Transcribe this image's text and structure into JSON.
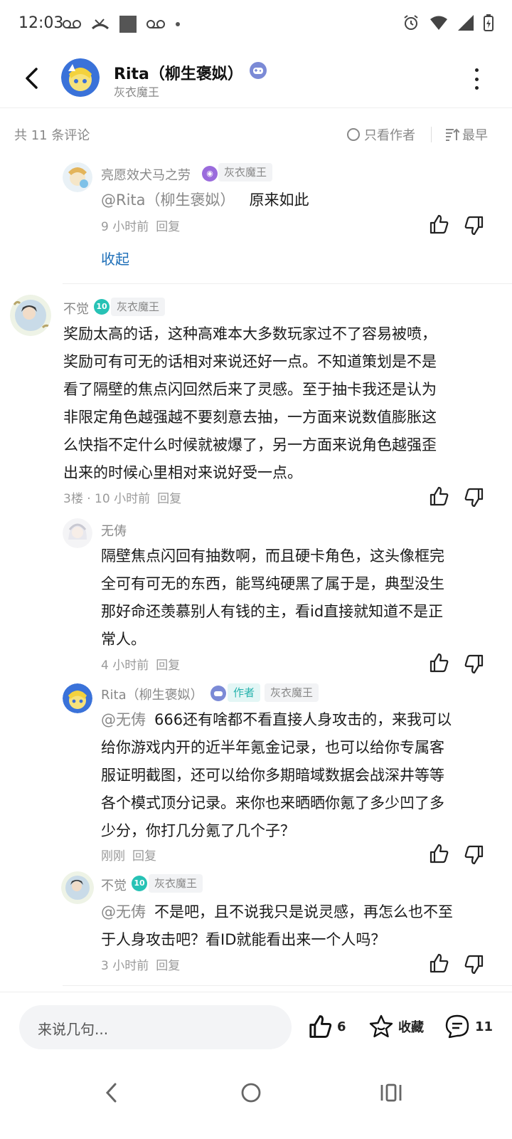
{
  "status_bar": {
    "time": "12:03",
    "icons_left": [
      "voicemail-icon",
      "missed-call-icon",
      "square-icon",
      "voicemail-icon",
      "dot-icon"
    ],
    "icons_right": [
      "alarm-icon",
      "wifi-icon",
      "signal-icon",
      "battery-icon"
    ]
  },
  "header": {
    "name": "Rita（柳生褒姒）",
    "subtitle": "灰衣魔王",
    "badge_icon": "gamepad-icon"
  },
  "filter_bar": {
    "count": "共 11 条评论",
    "author_only": "只看作者",
    "sort": "最早"
  },
  "comments": {
    "reply1": {
      "user": "亮愿效犬马之劳",
      "tag": "灰衣魔王",
      "mention": "@Rita（柳生褒姒）",
      "text": "原来如此",
      "time": "9 小时前",
      "reply": "回复"
    },
    "collapse": "收起",
    "main": {
      "user": "不觉",
      "level": "10",
      "tag": "灰衣魔王",
      "text": "奖励太高的话，这种高难本大多数玩家过不了容易被喷，奖励可有可无的话相对来说还好一点。不知道策划是不是看了隔壁的焦点闪回然后来了灵感。至于抽卡我还是认为非限定角色越强越不要刻意去抽，一方面来说数值膨胀这么快指不定什么时候就被爆了，另一方面来说角色越强歪出来的时候心里相对来说好受一点。",
      "lines": [
        "奖励太高的话，这种高难本大多数玩家过不了容易被喷，",
        "奖励可有可无的话相对来说还好一点。不知道策划是不是",
        "看了隔壁的焦点闪回然后来了灵感。至于抽卡我还是认为",
        "非限定角色越强越不要刻意去抽，一方面来说数值膨胀这",
        "么快指不定什么时候就被爆了，另一方面来说角色越强歪",
        "出来的时候心里相对来说好受一点。"
      ],
      "meta": "3楼 · 10 小时前",
      "reply": "回复"
    },
    "sub1": {
      "user": "无俦",
      "lines": [
        "隔壁焦点闪回有抽数啊，而且硬卡角色，这头像框完",
        "全可有可无的东西，能骂纯硬黑了属于是，典型没生",
        "那好命还羡慕别人有钱的主，看id直接就知道不是正",
        "常人。"
      ],
      "time": "4 小时前",
      "reply": "回复"
    },
    "sub2": {
      "user": "Rita（柳生褒姒）",
      "author_tag": "作者",
      "tag": "灰衣魔王",
      "mention": "@无俦",
      "lines": [
        "666还有啥都不看直接人身攻击的，来我可以",
        "给你游戏内开的近半年氪金记录，也可以给你专属客",
        "服证明截图，还可以给你多期暗域数据会战深井等等",
        "各个模式顶分记录。来你也来晒晒你氪了多少凹了多",
        "少分，你打几分氪了几个子？"
      ],
      "time": "刚刚",
      "reply": "回复"
    },
    "sub3": {
      "user": "不觉",
      "level": "10",
      "tag": "灰衣魔王",
      "mention": "@无俦",
      "lines": [
        "不是吧，且不说我只是说灵感，再怎么也不至",
        "于人身攻击吧？看ID就能看出来一个人吗？"
      ],
      "time": "3 小时前",
      "reply": "回复"
    }
  },
  "bottom_bar": {
    "placeholder": "来说几句...",
    "like_count": "6",
    "favorite": "收藏",
    "comment_count": "11"
  },
  "colors": {
    "link": "#1e6fb8",
    "author_tag_bg": "#e3f6f5",
    "author_tag_text": "#27b3ad",
    "level_badge": "#27c2b5",
    "gray_text": "#888888"
  }
}
